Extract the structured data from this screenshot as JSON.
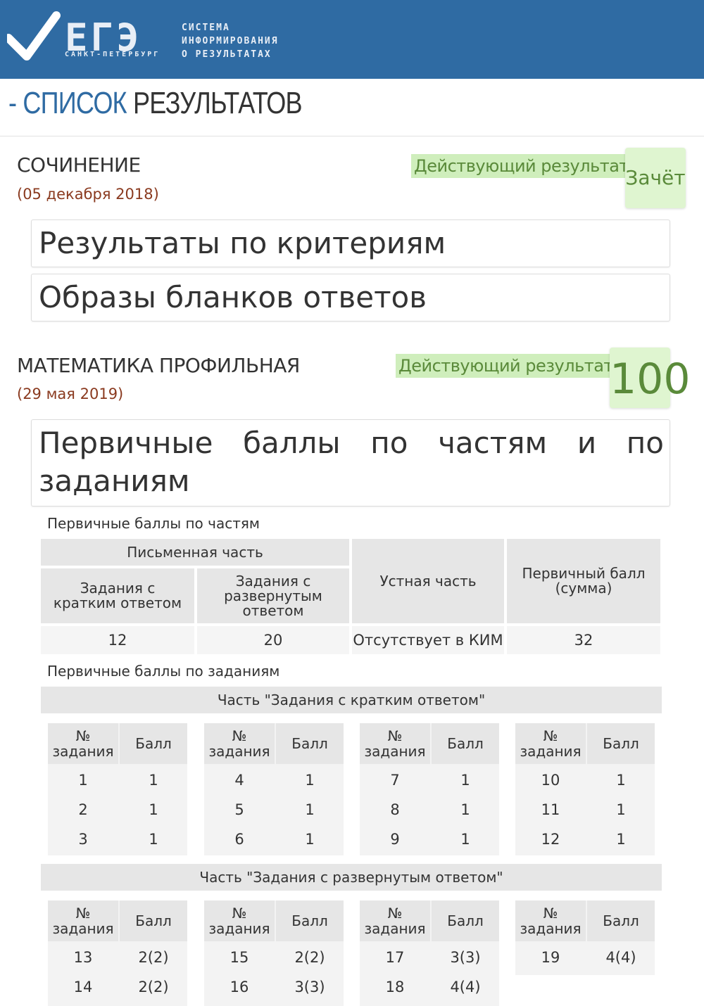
{
  "header": {
    "logo_text": "ЕГЭ",
    "logo_city": "САНКТ-ПЕТЕРБУРГ",
    "tagline": [
      "СИСТЕМА",
      "ИНФОРМИРОВАНИЯ",
      "О РЕЗУЛЬТАТАХ"
    ]
  },
  "page_title": {
    "dash": "-",
    "word1": "СПИСОК",
    "word2": "РЕЗУЛЬТАТОВ"
  },
  "exams": [
    {
      "name": "СОЧИНЕНИЕ",
      "date": "(05 декабря 2018)",
      "result_label": "Действующий результат",
      "result_value": "Зачёт",
      "panels": [
        "Результаты по критериям",
        "Образы бланков ответов"
      ]
    },
    {
      "name": "МАТЕМАТИКА ПРОФИЛЬНАЯ",
      "date": "(29 мая 2019)",
      "result_label": "Действующий результат",
      "result_value": "100",
      "panel_title_line1": [
        "Первичные",
        "баллы",
        "по",
        "частям",
        "и",
        "по"
      ],
      "panel_title_line2": "заданиям"
    }
  ],
  "parts": {
    "caption": "Первичные баллы по частям",
    "written_header": "Письменная часть",
    "short_header": "Задания с кратким ответом",
    "long_header": "Задания с развернутым ответом",
    "oral_header": "Устная часть",
    "sum_header": "Первичный балл (сумма)",
    "values": {
      "short": "12",
      "long": "20",
      "oral": "Отсутствует в КИМ",
      "sum": "32"
    }
  },
  "tasks": {
    "caption": "Первичные баллы по заданиям",
    "col_task": "№ задания",
    "col_score": "Балл",
    "short_part": {
      "title": "Часть \"Задания с кратким ответом\"",
      "groups": [
        [
          [
            "1",
            "1"
          ],
          [
            "2",
            "1"
          ],
          [
            "3",
            "1"
          ]
        ],
        [
          [
            "4",
            "1"
          ],
          [
            "5",
            "1"
          ],
          [
            "6",
            "1"
          ]
        ],
        [
          [
            "7",
            "1"
          ],
          [
            "8",
            "1"
          ],
          [
            "9",
            "1"
          ]
        ],
        [
          [
            "10",
            "1"
          ],
          [
            "11",
            "1"
          ],
          [
            "12",
            "1"
          ]
        ]
      ]
    },
    "long_part": {
      "title": "Часть \"Задания с развернутым ответом\"",
      "groups": [
        [
          [
            "13",
            "2(2)"
          ],
          [
            "14",
            "2(2)"
          ]
        ],
        [
          [
            "15",
            "2(2)"
          ],
          [
            "16",
            "3(3)"
          ]
        ],
        [
          [
            "17",
            "3(3)"
          ],
          [
            "18",
            "4(4)"
          ]
        ],
        [
          [
            "19",
            "4(4)"
          ]
        ]
      ]
    }
  },
  "colors": {
    "header_bg": "#2f6ba3",
    "accent_green": "#cfeebc",
    "date_color": "#8a3a1f"
  }
}
